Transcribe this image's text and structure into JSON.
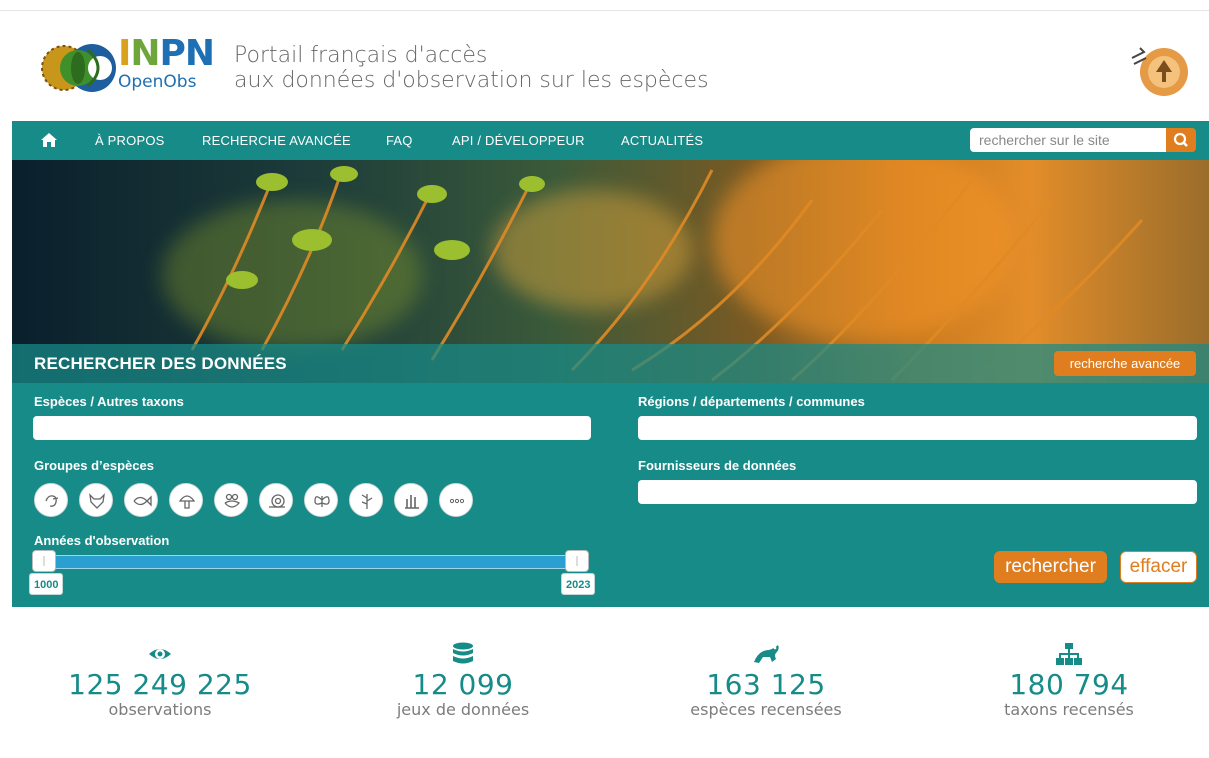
{
  "header": {
    "logo_main": [
      "I",
      "N",
      "PN"
    ],
    "logo_sub": "OpenObs",
    "tagline_line1": "Portail français d'accès",
    "tagline_line2": "aux données d'observation sur les espèces"
  },
  "nav": {
    "items": [
      "À PROPOS",
      "RECHERCHE AVANCÉE",
      "FAQ",
      "API / DÉVELOPPEUR",
      "ACTUALITÉS"
    ],
    "search_placeholder": "rechercher sur le site",
    "home_icon": "home-icon",
    "search_icon": "search-icon"
  },
  "hero": {
    "title": "RECHERCHER DES DONNÉES",
    "advanced_button": "recherche avancée"
  },
  "form": {
    "species_label": "Espèces / Autres taxons",
    "regions_label": "Régions / départements / communes",
    "groups_label": "Groupes d’espèces",
    "providers_label": "Fournisseurs de données",
    "years_label": "Années d'observation",
    "groups": [
      "bird-icon",
      "fox-icon",
      "fish-icon",
      "mushroom-icon",
      "frog-icon",
      "snail-icon",
      "butterfly-icon",
      "plant-icon",
      "coral-icon",
      "more-icon"
    ],
    "years_min": "1000",
    "years_max": "2023",
    "search_button": "rechercher",
    "clear_button": "effacer"
  },
  "stats": [
    {
      "icon": "eye-icon",
      "value": "125 249 225",
      "caption": "observations"
    },
    {
      "icon": "database-icon",
      "value": "12 099",
      "caption": "jeux de données"
    },
    {
      "icon": "frog-icon",
      "value": "163 125",
      "caption": "espèces recensées"
    },
    {
      "icon": "sitemap-icon",
      "value": "180 794",
      "caption": "taxons recensés"
    }
  ],
  "colors": {
    "teal": "#178b88",
    "orange": "#e07d1f"
  }
}
